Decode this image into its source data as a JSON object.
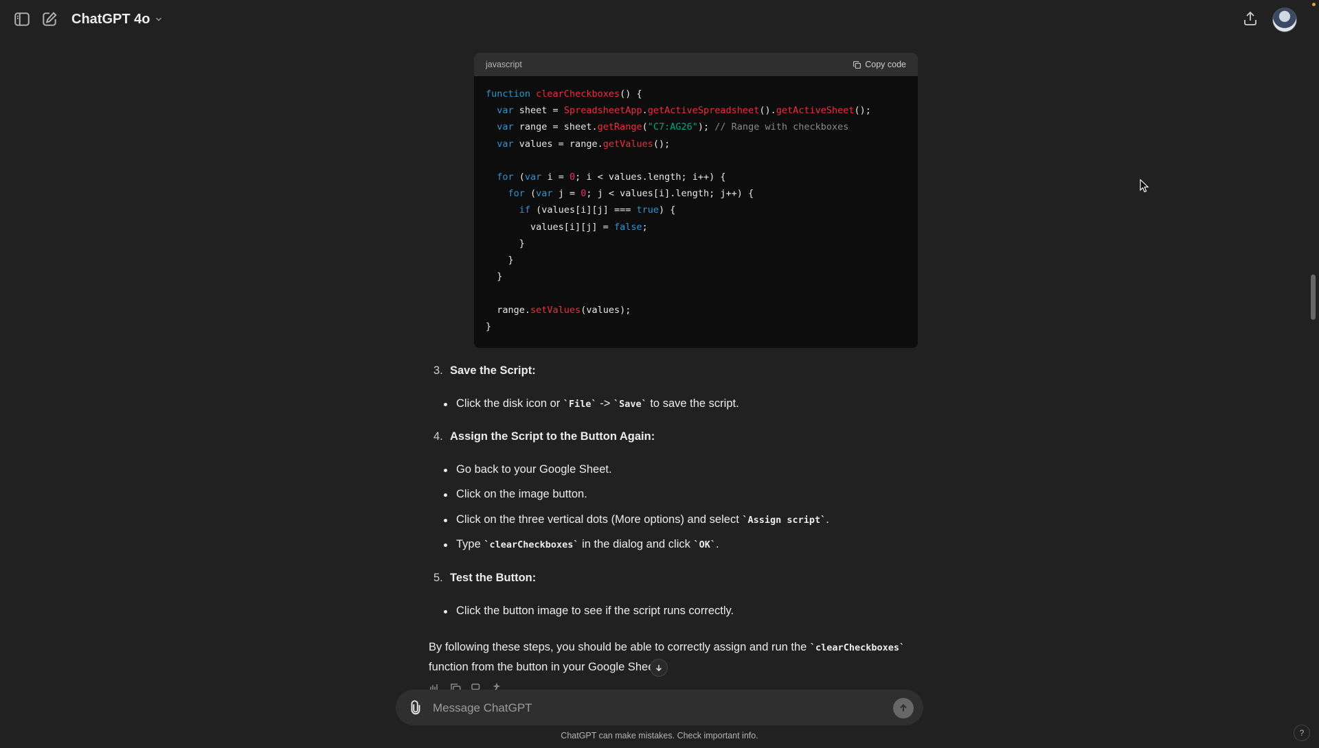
{
  "header": {
    "model_name": "ChatGPT 4o",
    "icons": {
      "sidebar_toggle": "sidebar-icon",
      "new_chat": "edit-icon",
      "share": "share-icon",
      "model_menu": "chevron-down-icon"
    }
  },
  "code_block": {
    "language": "javascript",
    "copy_label": "Copy code",
    "lines": [
      "function clearCheckboxes() {",
      "  var sheet = SpreadsheetApp.getActiveSpreadsheet().getActiveSheet();",
      "  var range = sheet.getRange(\"C7:AG26\"); // Range with checkboxes",
      "  var values = range.getValues();",
      "",
      "  for (var i = 0; i < values.length; i++) {",
      "    for (var j = 0; j < values[i].length; j++) {",
      "      if (values[i][j] === true) {",
      "        values[i][j] = false;",
      "      }",
      "    }",
      "  }",
      "",
      "  range.setValues(values);",
      "}"
    ]
  },
  "steps": [
    {
      "number": "3.",
      "title": "Save the Script:",
      "bullets": [
        [
          "Click the disk icon or ",
          "`File`",
          " -> ",
          "`Save`",
          " to save the script."
        ]
      ]
    },
    {
      "number": "4.",
      "title": "Assign the Script to the Button Again:",
      "bullets": [
        [
          "Go back to your Google Sheet."
        ],
        [
          "Click on the image button."
        ],
        [
          "Click on the three vertical dots (More options) and select ",
          "`Assign script`",
          "."
        ],
        [
          "Type ",
          "`clearCheckboxes`",
          " in the dialog and click ",
          "`OK`",
          "."
        ]
      ]
    },
    {
      "number": "5.",
      "title": "Test the Button:",
      "bullets": [
        [
          "Click the button image to see if the script runs correctly."
        ]
      ]
    }
  ],
  "closing": {
    "line1_pre": "By following these steps, you should be able to correctly assign and run the ",
    "line1_code": "`clearCheckboxes`",
    "line2": "function from the button in your Google Shee"
  },
  "composer": {
    "placeholder": "Message ChatGPT",
    "icons": {
      "attach": "paperclip-icon",
      "send": "arrow-up-icon"
    }
  },
  "disclaimer": "ChatGPT can make mistakes. Check important info.",
  "help_label": "?"
}
